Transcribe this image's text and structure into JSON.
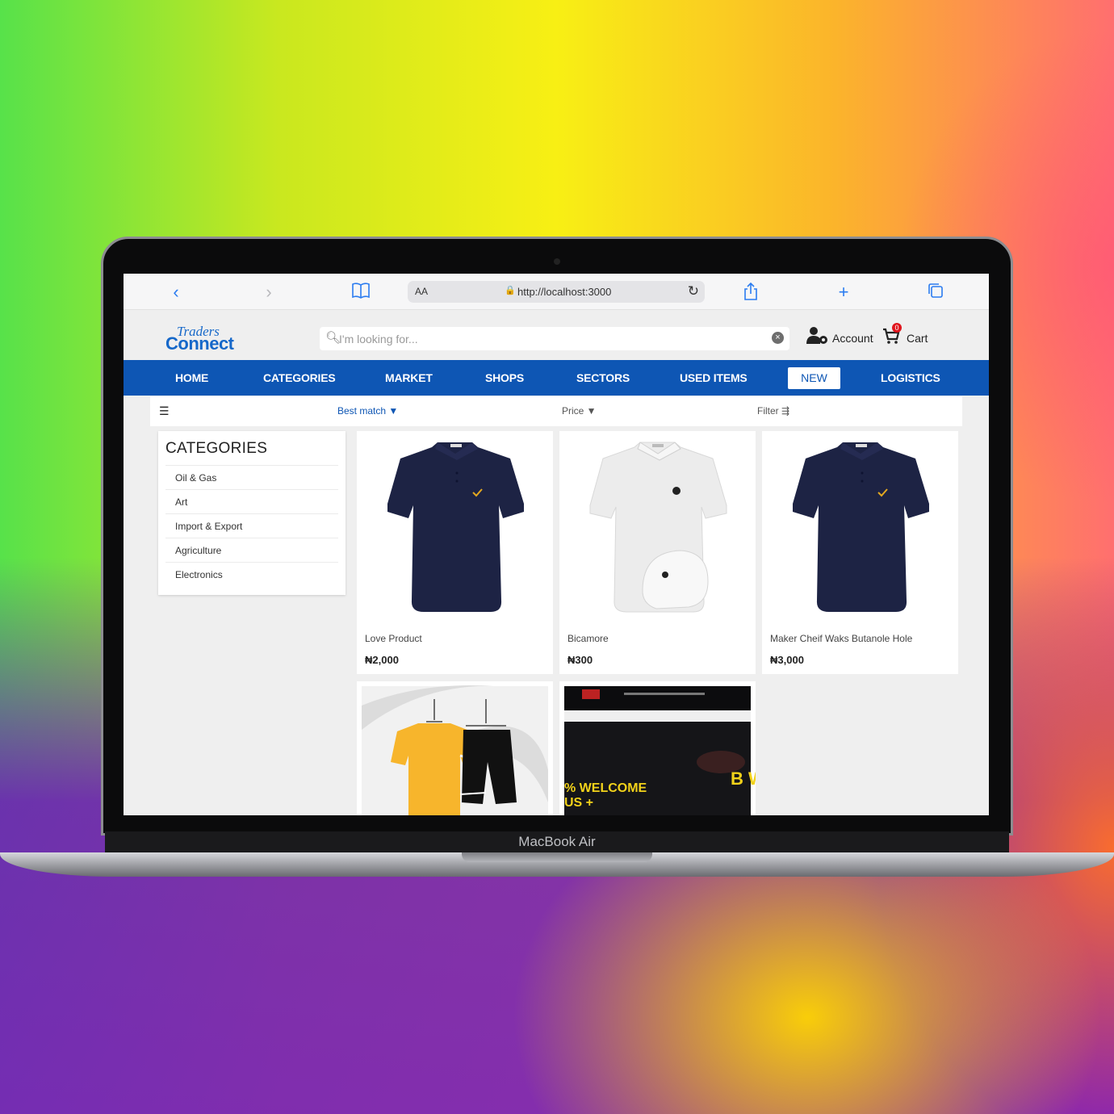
{
  "device": {
    "label": "MacBook Air"
  },
  "browser": {
    "address": "http://localhost:3000",
    "text_size_label": "AA"
  },
  "header": {
    "logo_line1": "Traders",
    "logo_line2": "Connect",
    "search_placeholder": "I'm looking for...",
    "account_label": "Account",
    "cart_label": "Cart",
    "cart_count": "0"
  },
  "nav": {
    "items": [
      "HOME",
      "CATEGORIES",
      "MARKET",
      "SHOPS",
      "SECTORS",
      "USED ITEMS",
      "NEW",
      "LOGISTICS"
    ]
  },
  "sortbar": {
    "best_match": "Best match ▼",
    "price": "Price ▼",
    "filter": "Filter ⇶"
  },
  "categories": {
    "title": "CATEGORIES",
    "items": [
      "Oil & Gas",
      "Art",
      "Import & Export",
      "Agriculture",
      "Electronics"
    ]
  },
  "products": [
    {
      "name": "Love Product",
      "price": "₦2,000",
      "image": "navy-polo-shirt"
    },
    {
      "name": "Bicamore",
      "price": "₦300",
      "image": "white-polo-and-cap"
    },
    {
      "name": "Maker Cheif Waks Butanole Hole",
      "price": "₦3,000",
      "image": "navy-polo-shirt"
    },
    {
      "name": "",
      "price": "",
      "image": "yellow-tshirt-shorts-set"
    },
    {
      "name": "",
      "price": "",
      "image": "website-banner"
    }
  ],
  "banner_text": {
    "welcome": "% WELCOME",
    "bonus": "US +",
    "big_letters": "B W"
  },
  "colors": {
    "nav_blue": "#0e56b4",
    "polo_navy": "#1d2344",
    "accent_gold": "#e3a820",
    "badge_red": "#e0141c"
  }
}
